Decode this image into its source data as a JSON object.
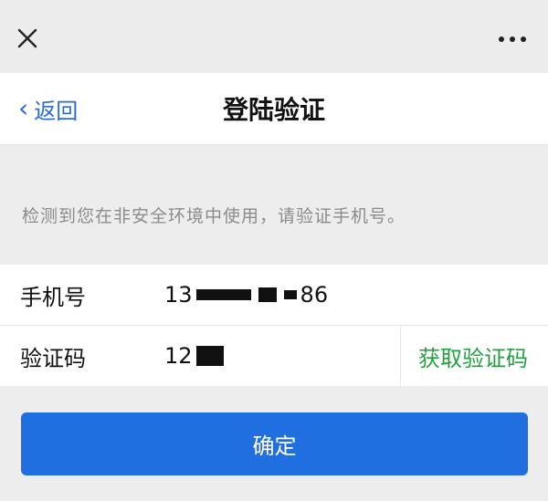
{
  "topbar": {
    "close_icon": "close-icon",
    "more_icon": "more-icon"
  },
  "header": {
    "back_label": "返回",
    "back_icon": "chevron-left-icon",
    "title": "登陆验证"
  },
  "notice": "检测到您在非安全环境中使用，请验证手机号。",
  "form": {
    "phone": {
      "label": "手机号",
      "value_prefix": "13",
      "value_suffix": "86"
    },
    "code": {
      "label": "验证码",
      "value_prefix": "12",
      "get_code_label": "获取验证码"
    }
  },
  "confirm_label": "确定",
  "colors": {
    "accent_blue": "#1f6fe0",
    "link_blue": "#2b6bd6",
    "green": "#22a140",
    "muted_text": "#8b8b8b",
    "background": "#ededed"
  }
}
